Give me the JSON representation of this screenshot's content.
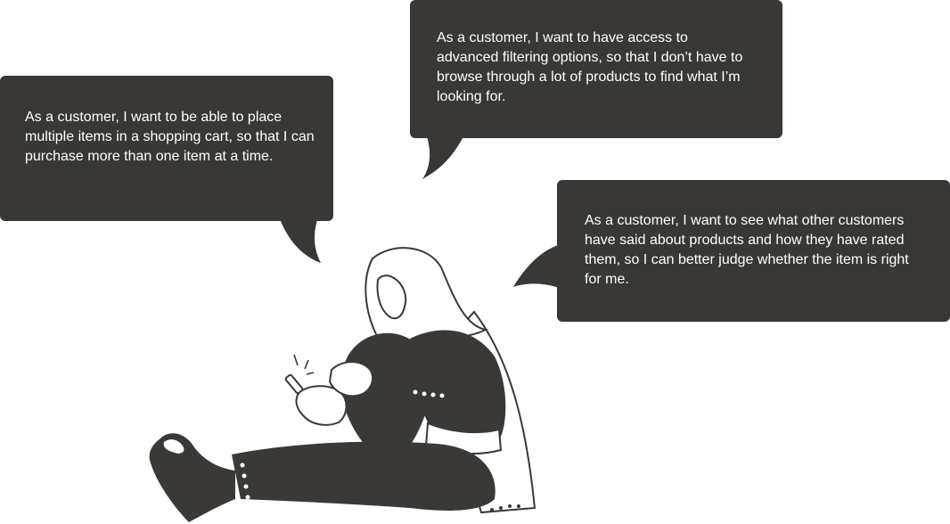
{
  "bubbles": {
    "left": {
      "text": "As a customer, I want to be able to place multiple items in  a  shopping cart, so that I can purchase more than one item at a time."
    },
    "top": {
      "text": "As a customer, I want to have access to advanced filtering options, so that I don’t have to browse through a lot of products to find what I’m looking  for."
    },
    "right": {
      "text": "As a customer, I want to see what other customers have said about products and how they have rated them, so I can better judge whether the item is right for me."
    }
  },
  "colors": {
    "bubble_background": "#393835",
    "bubble_text": "#ffffff",
    "illustration_fill": "#3a3936",
    "page_background": "#ffffff"
  },
  "illustration": {
    "icon": "woman-sitting-with-phone-illustration"
  }
}
